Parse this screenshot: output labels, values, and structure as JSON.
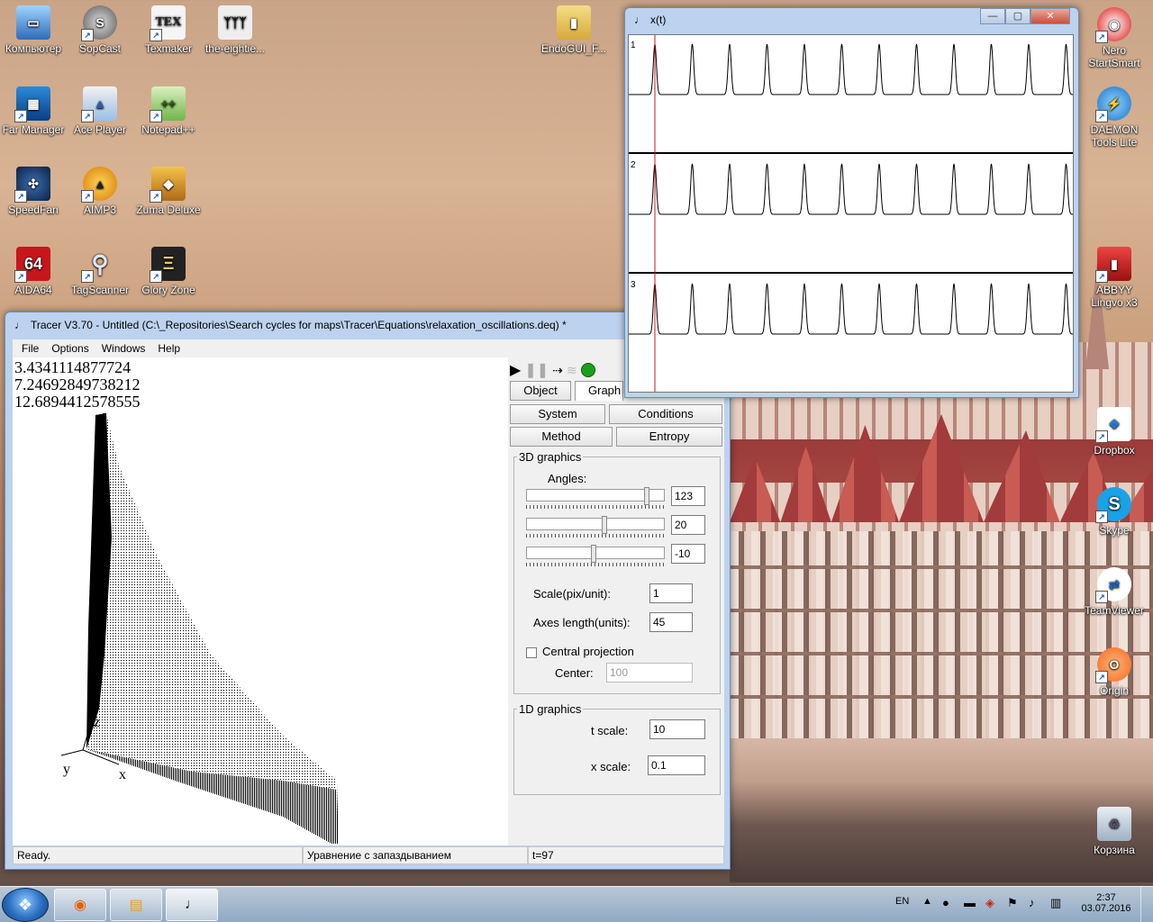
{
  "desktop": {
    "icons": [
      {
        "label": "Компьютер",
        "icon": "computer-icon"
      },
      {
        "label": "SopCast",
        "icon": "sopcast-icon"
      },
      {
        "label": "Texmaker",
        "icon": "texmaker-icon"
      },
      {
        "label": "the-eightie...",
        "icon": "image-file-icon"
      },
      {
        "label": "EndoGUI_F...",
        "icon": "folder-icon"
      },
      {
        "label": "Far Manager",
        "icon": "far-manager-icon"
      },
      {
        "label": "Ace Player",
        "icon": "ace-player-icon"
      },
      {
        "label": "Notepad++",
        "icon": "notepad-plus-icon"
      },
      {
        "label": "SpeedFan",
        "icon": "speedfan-icon"
      },
      {
        "label": "AIMP3",
        "icon": "aimp-icon"
      },
      {
        "label": "Zuma Deluxe",
        "icon": "zuma-icon"
      },
      {
        "label": "AIDA64",
        "icon": "aida64-icon"
      },
      {
        "label": "TagScanner",
        "icon": "tagscanner-icon"
      },
      {
        "label": "Glory Zone",
        "icon": "glory-zone-icon"
      },
      {
        "label": "Nero StartSmart",
        "icon": "nero-icon"
      },
      {
        "label": "DAEMON Tools Lite",
        "icon": "daemon-tools-icon"
      },
      {
        "label": "ABBYY Lingvo x3",
        "icon": "abbyy-icon"
      },
      {
        "label": "Dropbox",
        "icon": "dropbox-icon"
      },
      {
        "label": "Skype",
        "icon": "skype-icon"
      },
      {
        "label": "TeamViewer",
        "icon": "teamviewer-icon"
      },
      {
        "label": "Origin",
        "icon": "origin-icon"
      },
      {
        "label": "Корзина",
        "icon": "recycle-bin-icon"
      }
    ]
  },
  "tracer": {
    "title": "Tracer V3.70 - Untitled (C:\\_Repositories\\Search cycles for maps\\Tracer\\Equations\\relaxation_oscillations.deq) *",
    "menu": [
      "File",
      "Options",
      "Windows",
      "Help"
    ],
    "values": [
      "3.4341114877724",
      "7.24692849738212",
      "12.6894412578555"
    ],
    "axes": {
      "z": "z",
      "y": "y",
      "x": "x"
    },
    "tabs": {
      "object": "Object",
      "graph": "Graph"
    },
    "buttons": {
      "system": "System",
      "conditions": "Conditions",
      "method": "Method",
      "entropy": "Entropy"
    },
    "graphics3d": {
      "label": "3D graphics",
      "angles_label": "Angles:",
      "angle1": "123",
      "angle2": "20",
      "angle3": "-10",
      "angle1_fraction": 0.88,
      "angle2_fraction": 0.56,
      "angle3_fraction": 0.48,
      "scale_label": "Scale(pix/unit):",
      "scale": "1",
      "axes_label": "Axes length(units):",
      "axes": "45",
      "central_label": "Central projection",
      "center_label": "Center:",
      "center": "100"
    },
    "graphics1d": {
      "label": "1D graphics",
      "tscale_label": "t scale:",
      "tscale": "10",
      "xscale_label": "x scale:",
      "xscale": "0.1"
    },
    "status": {
      "ready": "Ready.",
      "equation": "Уравнение с запаздыванием",
      "t": "t=97"
    }
  },
  "xwindow": {
    "title": "x(t)",
    "traces": [
      "1",
      "2",
      "3"
    ]
  },
  "taskbar": {
    "lang": "EN",
    "time": "2:37",
    "date": "03.07.2016"
  }
}
